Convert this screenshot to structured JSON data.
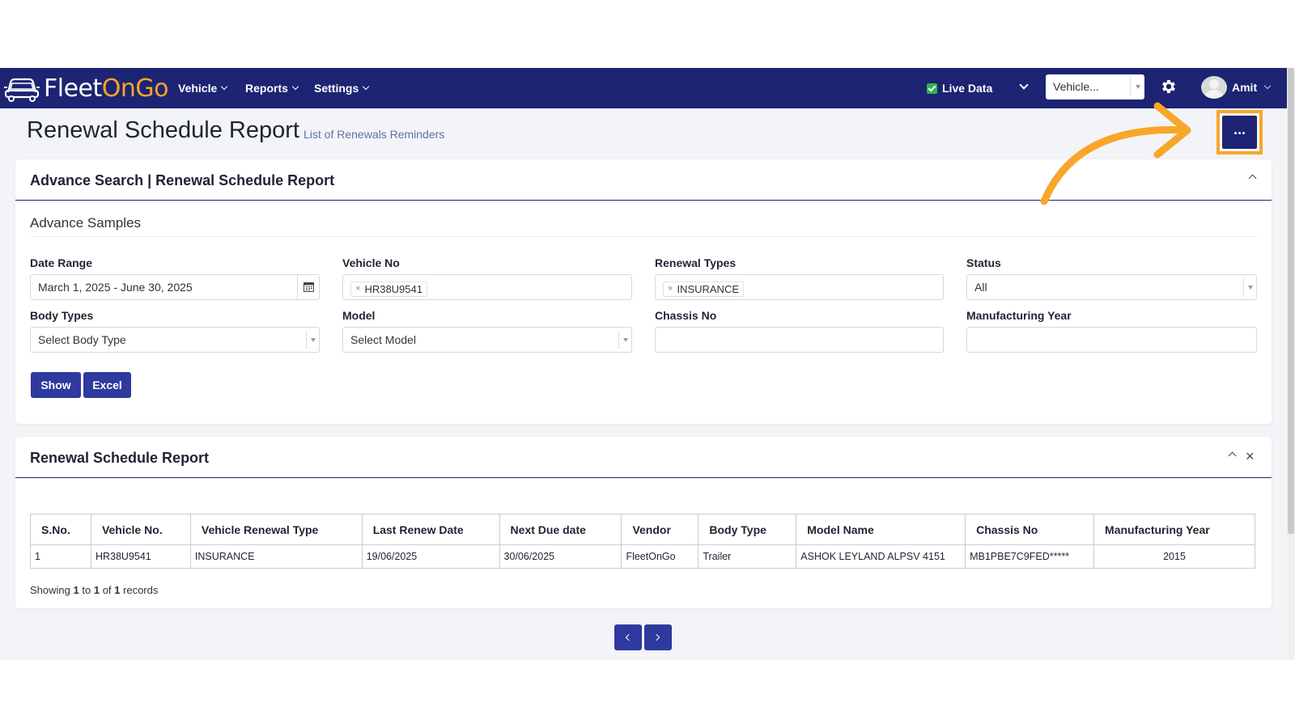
{
  "nav": {
    "logo_word_white": "Fleet",
    "logo_word_orange_1": "On",
    "logo_word_orange_2": "Go",
    "menu": [
      {
        "label": "Vehicle"
      },
      {
        "label": "Reports"
      },
      {
        "label": "Settings"
      }
    ],
    "live_data_label": "Live Data",
    "vehicle_select_value": "Vehicle...",
    "user_name": "Amit"
  },
  "page": {
    "title": "Renewal Schedule Report",
    "subtitle": "List of Renewals Reminders",
    "more_button": "..."
  },
  "search": {
    "card_title": "Advance Search | Renewal Schedule Report",
    "section_label": "Advance Samples",
    "fields": {
      "date_range": {
        "label": "Date Range",
        "value": "March 1, 2025 - June 30, 2025"
      },
      "vehicle_no": {
        "label": "Vehicle No",
        "tag": "HR38U9541"
      },
      "renewal_types": {
        "label": "Renewal Types",
        "tag": "INSURANCE"
      },
      "status": {
        "label": "Status",
        "value": "All"
      },
      "body_types": {
        "label": "Body Types",
        "placeholder": "Select Body Type"
      },
      "model": {
        "label": "Model",
        "placeholder": "Select Model"
      },
      "chassis_no": {
        "label": "Chassis No",
        "value": ""
      },
      "manufacturing_year": {
        "label": "Manufacturing Year",
        "value": ""
      }
    },
    "show_button": "Show",
    "excel_button": "Excel"
  },
  "report": {
    "card_title": "Renewal Schedule Report",
    "columns": [
      "S.No.",
      "Vehicle No.",
      "Vehicle Renewal Type",
      "Last Renew Date",
      "Next Due date",
      "Vendor",
      "Body Type",
      "Model Name",
      "Chassis No",
      "Manufacturing Year"
    ],
    "rows": [
      [
        "1",
        "HR38U9541",
        "INSURANCE",
        "19/06/2025",
        "30/06/2025",
        "FleetOnGo",
        "Trailer",
        "ASHOK LEYLAND ALPSV 4151",
        "MB1PBE7C9FED*****",
        "2015"
      ]
    ],
    "showing": {
      "prefix": "Showing",
      "from": "1",
      "to_word": "to",
      "to": "1",
      "of_word": "of",
      "total": "1",
      "suffix": "records"
    }
  },
  "icons": {
    "nav_chevron": "chevron-down-icon",
    "calendar": "calendar-icon",
    "settings": "gear-icon",
    "annotation": "curved-arrow-icon"
  },
  "colors": {
    "nav_bg": "#1c2473",
    "button": "#2e3a9e",
    "accent_orange": "#f8a629",
    "page_bg": "#f3f4f8"
  }
}
